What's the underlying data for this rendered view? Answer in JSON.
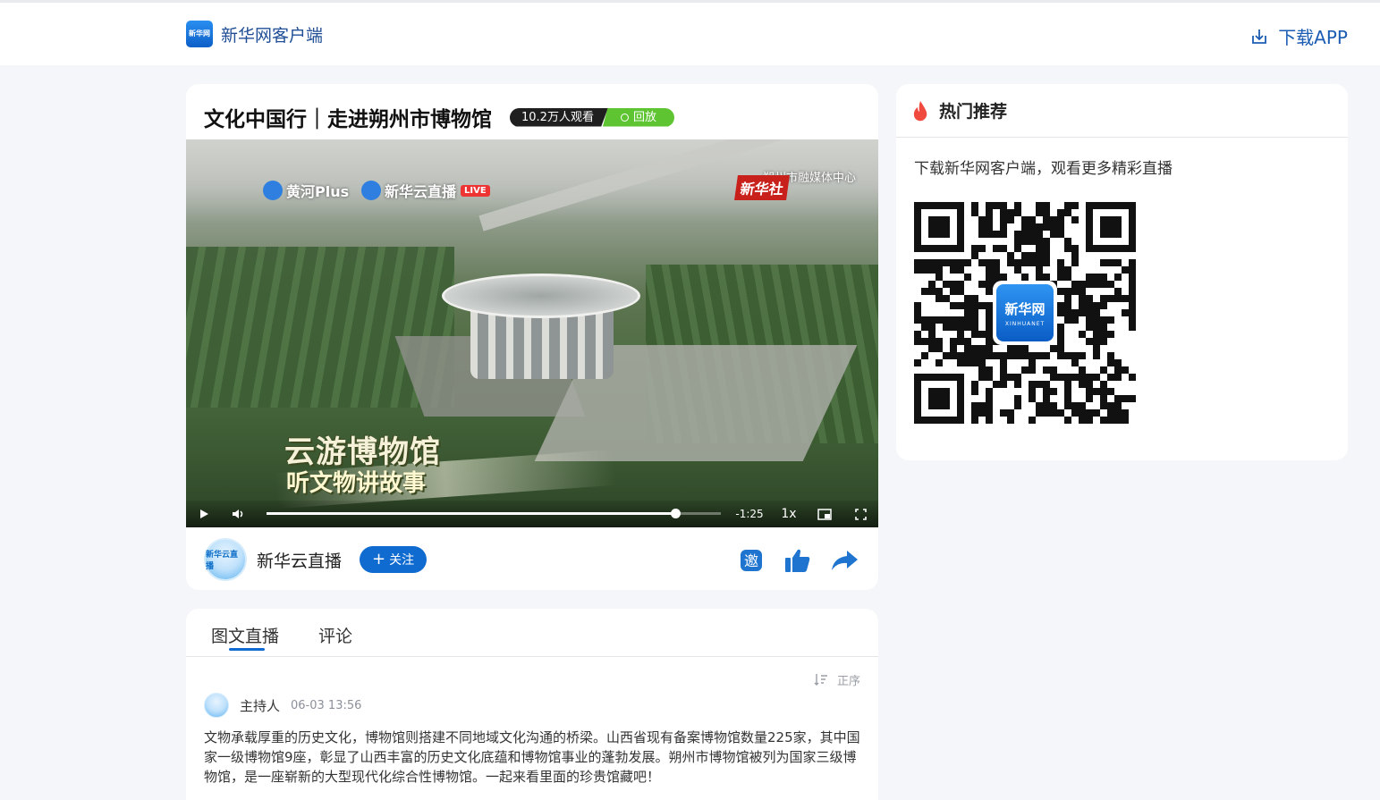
{
  "header": {
    "brand_logo_text": "新华网",
    "brand_name": "新华网客户端",
    "download_label": "下载APP"
  },
  "live": {
    "title": "文化中国行｜走进朔州市博物馆",
    "views": "10.2万人观看",
    "status": "回放",
    "video": {
      "watermark_left_1": "黄河Plus",
      "watermark_left_2": "新华云直播",
      "watermark_live": "LIVE",
      "stamp_brand": "新华社",
      "stamp_org": "朔州市融媒体中心",
      "caption_line1": "云游博物馆",
      "caption_line2": "听文物讲故事",
      "controls": {
        "time_remaining": "-1:25",
        "speed": "1x",
        "progress": 0.9
      }
    },
    "author": {
      "name": "新华云直播",
      "avatar_text": "新华云直播",
      "follow_label": "关注"
    }
  },
  "feed": {
    "tabs": [
      "图文直播",
      "评论"
    ],
    "active_tab": 0,
    "order_label": "正序",
    "posts": [
      {
        "author": "主持人",
        "time": "06-03 13:56",
        "body": "文物承载厚重的历史文化，博物馆则搭建不同地域文化沟通的桥梁。山西省现有备案博物馆数量225家，其中国家一级博物馆9座，彰显了山西丰富的历史文化底蕴和博物馆事业的蓬勃发展。朔州市博物馆被列为国家三级博物馆，是一座崭新的大型现代化综合性博物馆。一起来看里面的珍贵馆藏吧！"
      }
    ]
  },
  "side": {
    "title": "热门推荐",
    "description": "下载新华网客户端，观看更多精彩直播",
    "qr_logo_cn": "新华网",
    "qr_logo_en": "XINHUANET"
  },
  "colors": {
    "brand_blue": "#0f6bd0",
    "replay_green": "#5ec432",
    "hot_red": "#f04a3e",
    "background": "#f4f6f9"
  }
}
